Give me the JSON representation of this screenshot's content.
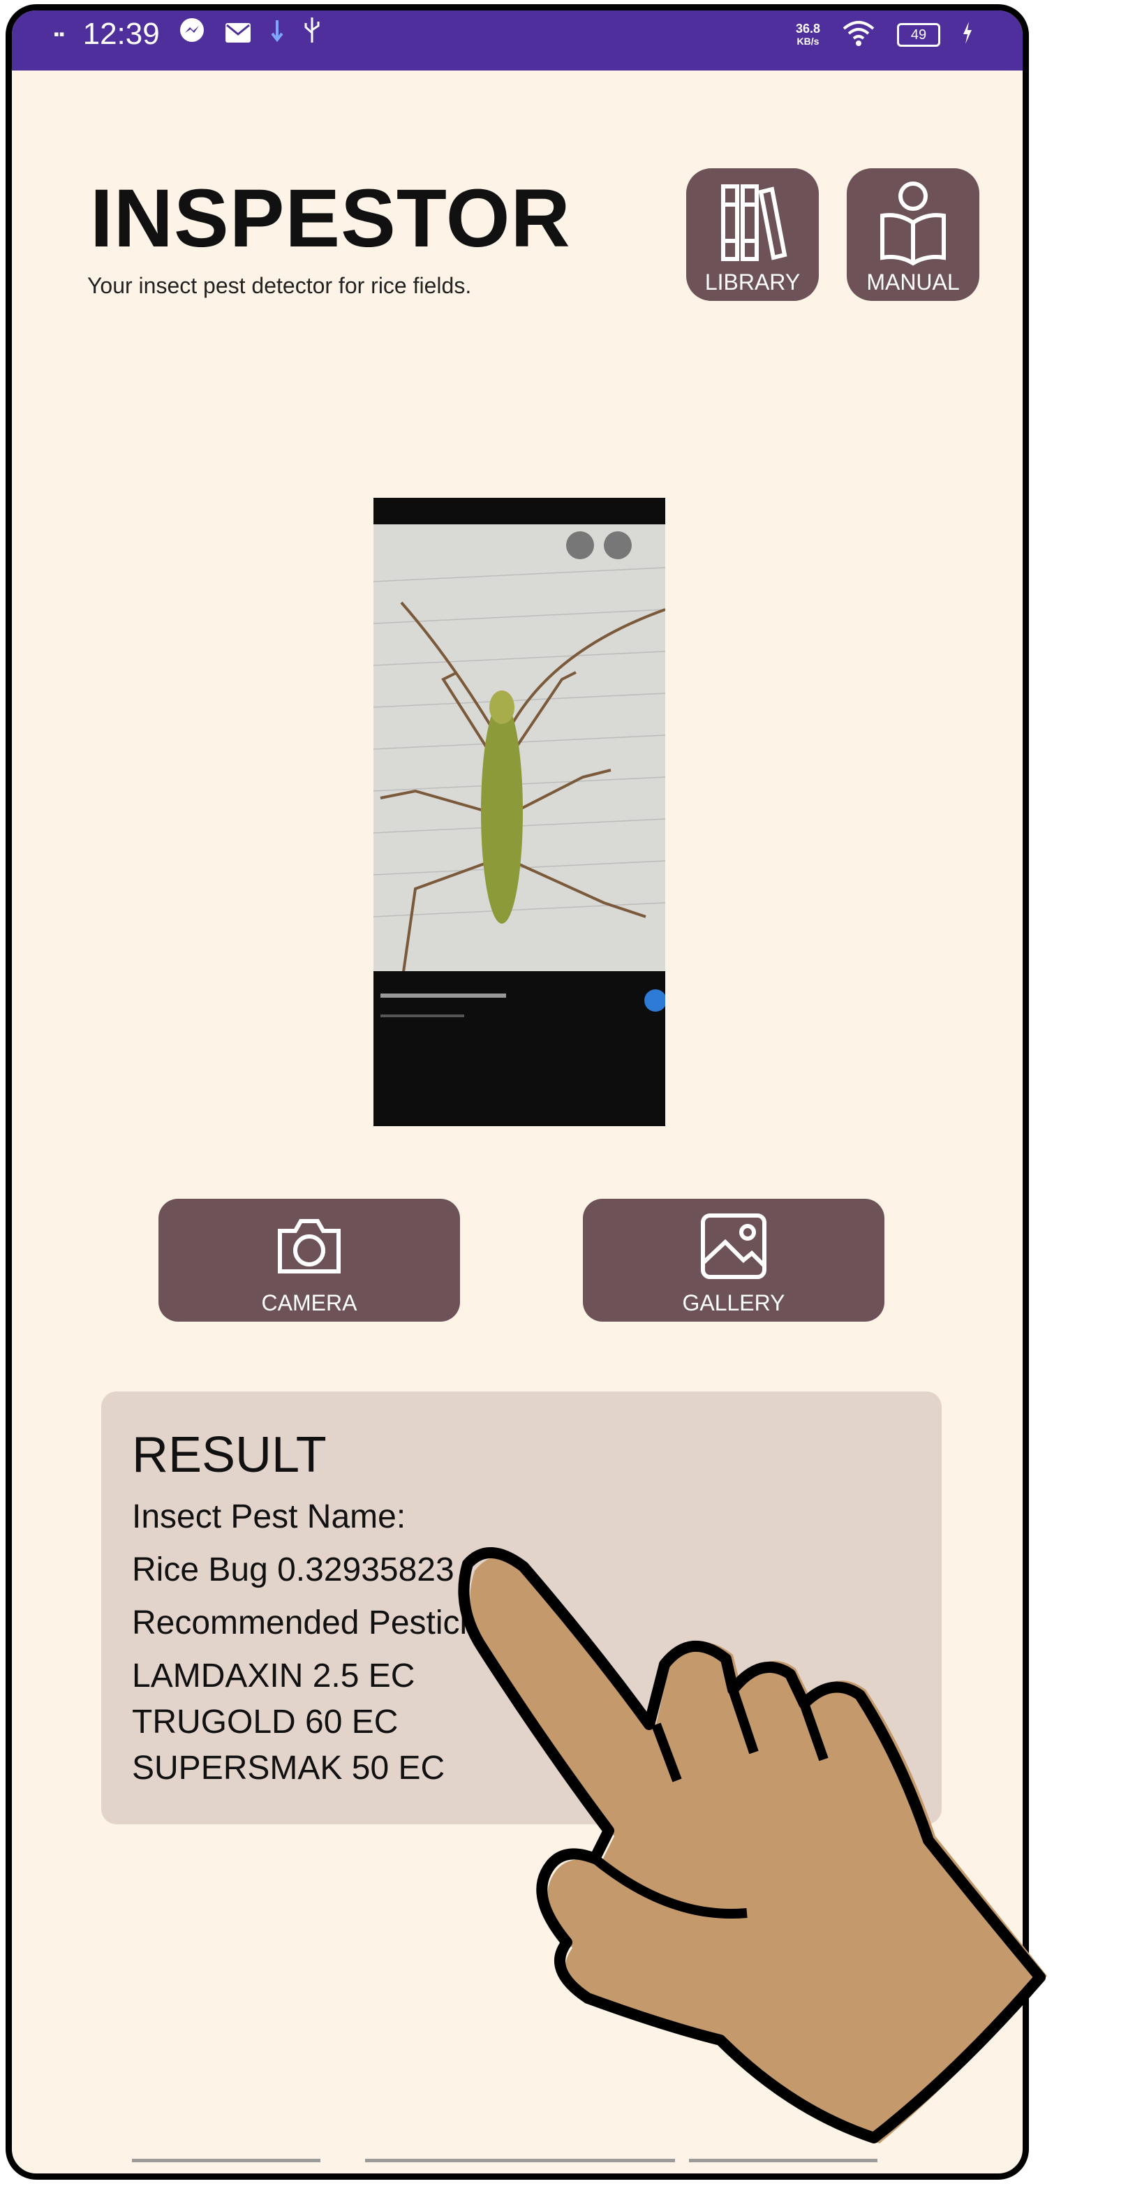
{
  "statusbar": {
    "time": "12:39",
    "network_speed": "36.8",
    "network_unit": "KB/s",
    "battery": "49"
  },
  "app": {
    "title": "INSPESTOR",
    "subtitle": "Your insect pest detector for rice fields."
  },
  "buttons": {
    "library": "LIBRARY",
    "manual": "MANUAL",
    "camera": "CAMERA",
    "gallery": "GALLERY"
  },
  "result": {
    "heading": "RESULT",
    "name_label": "Insect Pest Name:",
    "name_value": "Rice Bug 0.32935823",
    "recommend_label": "Recommended Pesticides:",
    "pesticides": [
      "LAMDAXIN 2.5 EC",
      "TRUGOLD 60 EC",
      "SUPERSMAK 50 EC"
    ]
  },
  "colors": {
    "statusbar": "#4e2f9c",
    "background": "#fdf3e6",
    "button": "#6d5257",
    "result_panel": "#e3d4cb",
    "hand_skin": "#c49a6c"
  }
}
